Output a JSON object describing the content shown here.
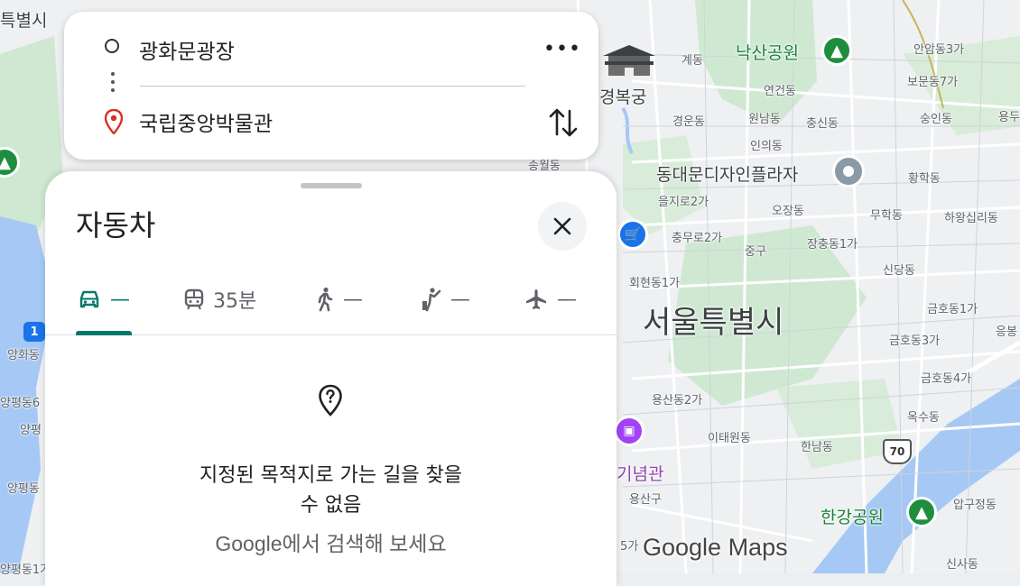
{
  "route": {
    "origin": "광화문광장",
    "destination": "국립중앙박물관",
    "more_label": "•••"
  },
  "sheet": {
    "title": "자동차",
    "modes": [
      {
        "id": "drive",
        "icon": "car-icon",
        "value": "—",
        "active": true
      },
      {
        "id": "transit",
        "icon": "train-icon",
        "value": "35분",
        "active": false
      },
      {
        "id": "walk",
        "icon": "walk-icon",
        "value": "—",
        "active": false
      },
      {
        "id": "ride",
        "icon": "ride-icon",
        "value": "—",
        "active": false
      },
      {
        "id": "flight",
        "icon": "airplane-icon",
        "value": "—",
        "active": false
      }
    ],
    "message_line1": "지정된 목적지로 가는 길을 찾을",
    "message_line2": "수 없음",
    "sub_message": "Google에서 검색해 보세요"
  },
  "map": {
    "watermark": "Google Maps",
    "labels": {
      "seoul": "서울특별시",
      "naksan": "낙산공원",
      "gyeongbokgung": "경복궁",
      "ddp": "동대문디자인플라자",
      "hangang": "한강공원",
      "museum_partial": "기념관",
      "gyedong": "계동",
      "yeongeondong": "연건동",
      "gyeongundong": "경운동",
      "wonnamdong": "원남동",
      "chungsindong": "충신동",
      "sunginDong": "숭인동",
      "boomundong": "보문동7가",
      "anamdong": "안암동3가",
      "yong": "용두",
      "inuidong": "인의동",
      "songwoldong": "송월동",
      "euljiro": "을지로2가",
      "ojangdong": "오장동",
      "hwanghakdong": "황학동",
      "muhakdong": "무학동",
      "hawangsimni": "하왕십리동",
      "chungmuro": "충무로2가",
      "junggu": "중구",
      "jangchungdong": "장충동1가",
      "sindangdong": "신당동",
      "hoehyeondong": "회현동1가",
      "geumhodong1": "금호동1가",
      "geumhodong3": "금호동3가",
      "geumhodong4": "금호동4가",
      "yongdap": "응봉",
      "yongsandong2": "용산동2가",
      "itaewon": "이태원동",
      "hannamdong": "한남동",
      "oksudong": "옥수동",
      "yongsangu": "용산구",
      "apgujeong": "압구정동",
      "sinsadong": "신사동",
      "teukbyeol": "특별시",
      "yanghwadong": "양화동",
      "yangpyeong6": "양평동6",
      "yangpyeong": "양평",
      "yangpyeongdong": "양평동",
      "yangpyeong1": "양평동1가",
      "five_ga": "5가",
      "route_70": "70",
      "route_1": "1"
    }
  },
  "colors": {
    "accent": "#00796b",
    "pin_red": "#d93025",
    "park_green": "#1e8e3e",
    "water": "#8ab4f8"
  }
}
